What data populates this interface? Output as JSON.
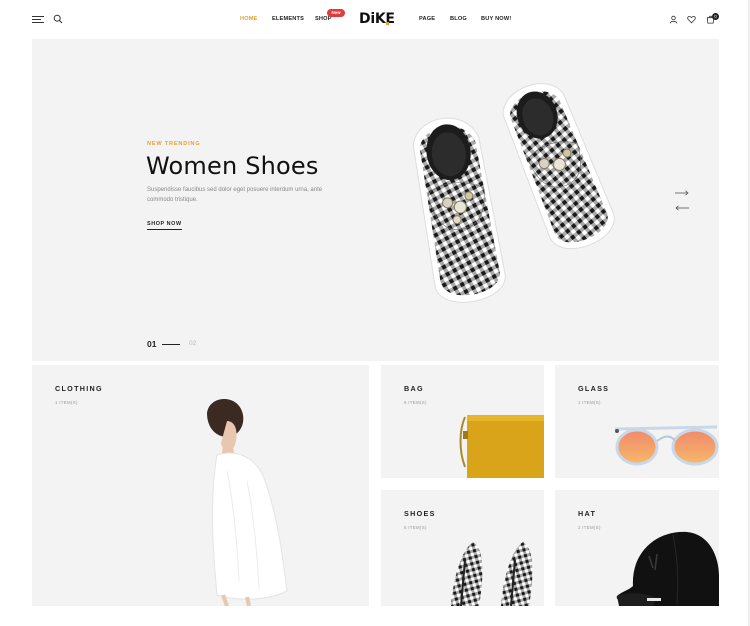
{
  "header": {
    "nav": [
      "HOME",
      "ELEMENTS",
      "SHOP",
      "PAGE",
      "BLOG",
      "BUY NOW!"
    ],
    "shop_badge": "New",
    "logo": "DiKE",
    "cart_count": "0"
  },
  "hero": {
    "kicker": "NEW TRENDING",
    "title": "Women Shoes",
    "description": "Suspendisse faucibus sed dolor eget posuere interdum urna, ante commodo tristique.",
    "cta": "SHOP NOW",
    "slide_current": "01",
    "slide_next": "02"
  },
  "categories": [
    {
      "title": "CLOTHING",
      "count": "1 ITEM(S)"
    },
    {
      "title": "BAG",
      "count": "6 ITEM(S)"
    },
    {
      "title": "GLASS",
      "count": "1 ITEM(S)"
    },
    {
      "title": "SHOES",
      "count": "6 ITEM(S)"
    },
    {
      "title": "HAT",
      "count": "2 ITEM(S)"
    }
  ],
  "colors": {
    "accent": "#e2a13c",
    "badge": "#e23b3b",
    "panel": "#f3f3f3"
  }
}
